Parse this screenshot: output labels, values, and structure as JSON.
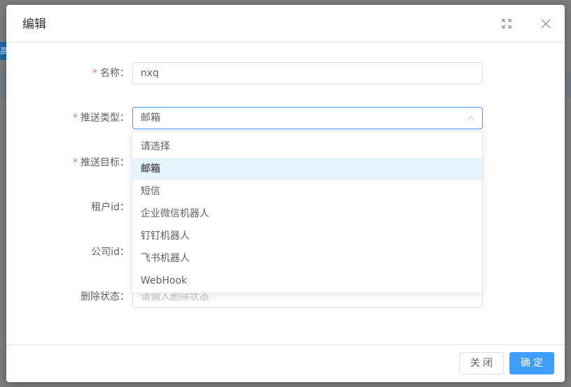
{
  "background": {
    "partial_button_text": "高"
  },
  "dialog": {
    "title": "编辑",
    "maximize_icon": "fullscreen-icon",
    "close_icon": "close-icon"
  },
  "form": {
    "name": {
      "label": "名称：",
      "required": true,
      "value": "nxq"
    },
    "push_type": {
      "label": "推送类型：",
      "required": true,
      "value": "邮箱"
    },
    "push_target": {
      "label": "推送目标：",
      "required": true
    },
    "tenant_id": {
      "label": "租户id：",
      "required": false
    },
    "company_id": {
      "label": "公司id：",
      "required": false
    },
    "delete_status": {
      "label": "删除状态：",
      "required": false,
      "placeholder": "请输入删除状态"
    }
  },
  "dropdown": {
    "options": [
      "请选择",
      "邮箱",
      "短信",
      "企业微信机器人",
      "钉钉机器人",
      "飞书机器人",
      "WebHook"
    ],
    "selected": "邮箱"
  },
  "footer": {
    "cancel_label": "关闭",
    "confirm_label": "确定"
  },
  "colors": {
    "primary": "#409eff",
    "required": "#f56c6c",
    "selected_bg": "#e8f4fd"
  }
}
